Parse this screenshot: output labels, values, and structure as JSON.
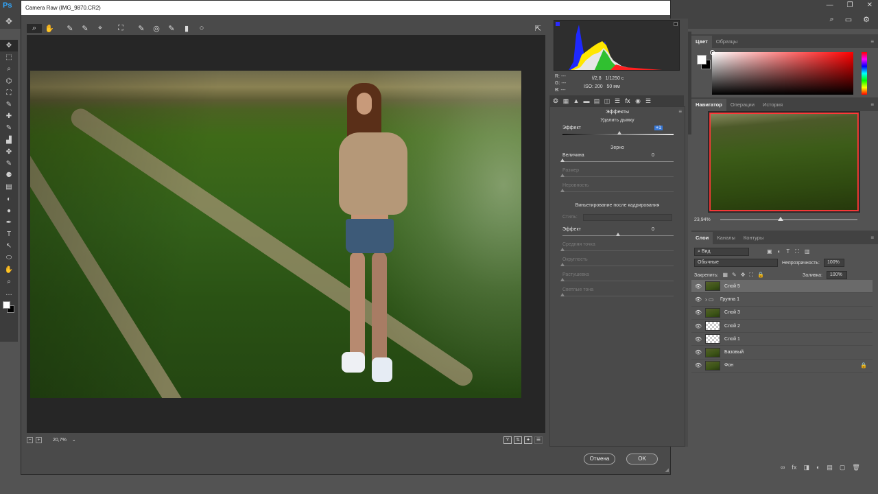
{
  "ps": {
    "logo": "Ps",
    "window_buttons": [
      "—",
      "❐",
      "✕"
    ],
    "top_right_icons": [
      "⌕",
      "▭",
      "⚙"
    ],
    "tools": [
      "✥",
      "⬚",
      "⌕",
      "⌬",
      "⛶",
      "✎",
      "✚",
      "✎",
      "▟",
      "✤",
      "✎",
      "⚈",
      "▤",
      "◐",
      "●",
      "✒",
      "T",
      "↖",
      "⬭",
      "✋",
      "⌕",
      "…"
    ],
    "dock_icons": [
      "✥",
      "≡",
      "⚲",
      "A|",
      "¶",
      "⚙"
    ]
  },
  "color_panel": {
    "tabs": [
      "Цвет",
      "Образцы"
    ],
    "menu": "≡"
  },
  "navigator_panel": {
    "tabs": [
      "Навигатор",
      "Операции",
      "История"
    ],
    "menu": "≡",
    "zoom": "23,94%"
  },
  "layers_panel": {
    "tabs": [
      "Слои",
      "Каналы",
      "Контуры"
    ],
    "menu": "≡",
    "filter_label": "⌕ Вид",
    "filter_icons": [
      "▣",
      "◐",
      "T",
      "⛶",
      "▥"
    ],
    "blend_mode": "Обычные",
    "opacity_label": "Непрозрачность:",
    "opacity_value": "100%",
    "lock_label": "Закрепить:",
    "lock_icons": [
      "▦",
      "✎",
      "✥",
      "⛶",
      "🔒"
    ],
    "fill_label": "Заливка:",
    "fill_value": "100%",
    "layers": [
      {
        "name": "Слой 5",
        "selected": true,
        "thumb": "photo",
        "folder": false,
        "locked": false
      },
      {
        "name": "Группа 1",
        "selected": false,
        "thumb": "folder",
        "folder": true,
        "locked": false
      },
      {
        "name": "Слой 3",
        "selected": false,
        "thumb": "photo",
        "folder": false,
        "locked": false
      },
      {
        "name": "Слой 2",
        "selected": false,
        "thumb": "trans",
        "folder": false,
        "locked": false
      },
      {
        "name": "Слой 1",
        "selected": false,
        "thumb": "trans",
        "folder": false,
        "locked": false
      },
      {
        "name": "Базовый",
        "selected": false,
        "thumb": "photo",
        "folder": false,
        "locked": false
      },
      {
        "name": "Фон",
        "selected": false,
        "thumb": "photo",
        "folder": false,
        "locked": true
      }
    ],
    "footer_icons": [
      "∞",
      "fx",
      "◨",
      "◐",
      "▤",
      "▢",
      "🗑"
    ]
  },
  "camera_raw": {
    "title": "Camera Raw (IMG_9870.CR2)",
    "tools": [
      "⌕",
      "✋",
      "✎",
      "✎",
      "⌖",
      "⛶",
      "✎",
      "◎",
      "✎",
      "▮",
      "○"
    ],
    "open_icon": "⇱",
    "zoom_level": "20,7%",
    "rgb": {
      "r": "R:  ---",
      "g": "G:  ---",
      "b": "B:  ---"
    },
    "exif": {
      "aperture": "f/2,8",
      "shutter": "1/1250 с",
      "iso": "ISO: 200",
      "focal": "50 мм"
    },
    "panel_tabs": [
      "❂",
      "▦",
      "▲",
      "▬",
      "▤",
      "◫",
      "☰",
      "fx",
      "◉",
      "☰"
    ],
    "effects_title": "Эффекты",
    "dehaze_title": "Удалить дымку",
    "dehaze_effect_label": "Эффект",
    "dehaze_effect_value": "+1",
    "dehaze_effect_level": 0.51,
    "grain_title": "Зерно",
    "grain_amount_label": "Величина",
    "grain_amount_value": "0",
    "grain_size_label": "Размер",
    "grain_roughness_label": "Неровность",
    "vignette_title": "Виньетирование после кадрирования",
    "vignette_style_label": "Стиль:",
    "vignette_effect_label": "Эффект",
    "vignette_effect_value": "0",
    "vignette_midpoint_label": "Средняя точка",
    "vignette_roundness_label": "Округлость",
    "vignette_feather_label": "Растушевка",
    "vignette_highlights_label": "Светлые тона",
    "cancel_label": "Отмена",
    "ok_label": "OK"
  }
}
